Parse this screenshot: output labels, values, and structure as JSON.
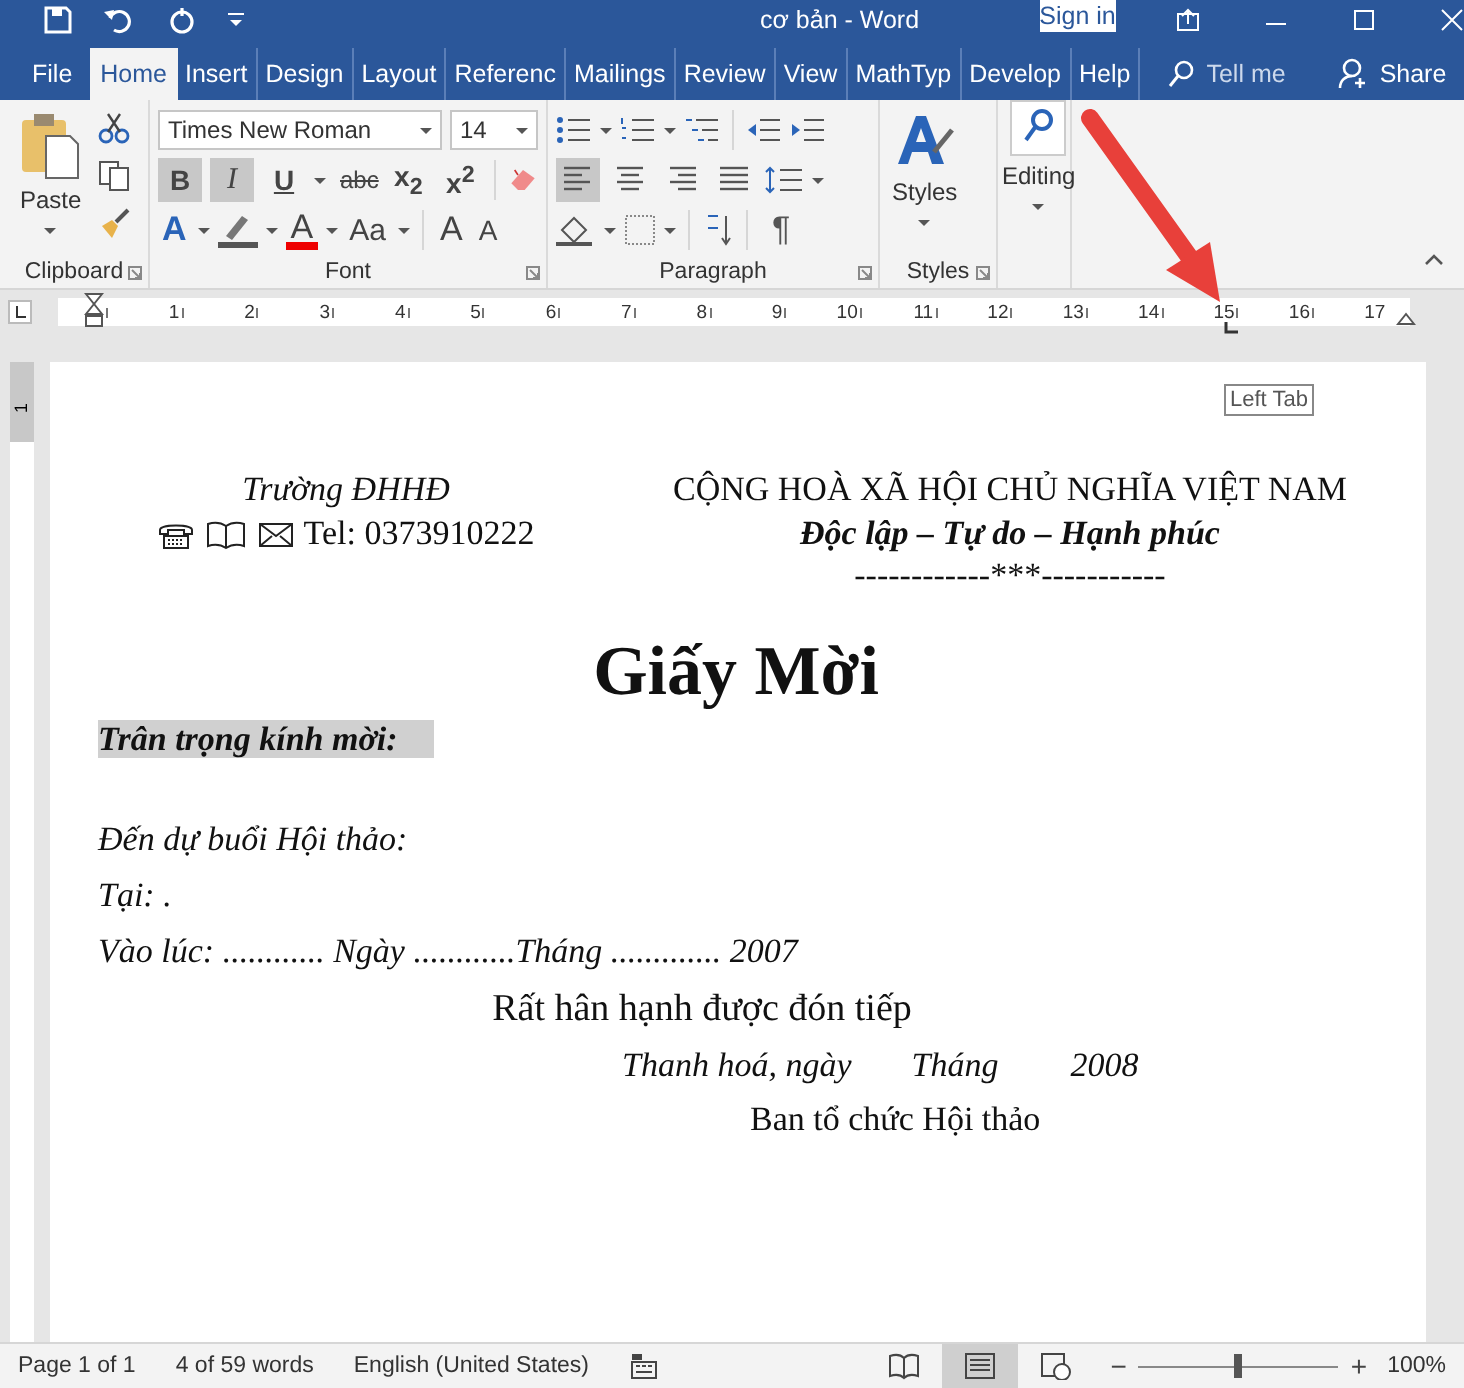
{
  "title_bar": {
    "title": "cơ bản - Word",
    "sign_in": "Sign in"
  },
  "tabs": [
    {
      "label": "File",
      "selected": false
    },
    {
      "label": "Home",
      "selected": true
    },
    {
      "label": "Insert",
      "selected": false
    },
    {
      "label": "Design",
      "selected": false
    },
    {
      "label": "Layout",
      "selected": false
    },
    {
      "label": "Referenc",
      "selected": false
    },
    {
      "label": "Mailings",
      "selected": false
    },
    {
      "label": "Review",
      "selected": false
    },
    {
      "label": "View",
      "selected": false
    },
    {
      "label": "MathTyp",
      "selected": false
    },
    {
      "label": "Develop",
      "selected": false
    },
    {
      "label": "Help",
      "selected": false
    }
  ],
  "tell_me": "Tell me",
  "share": "Share",
  "ribbon": {
    "clipboard": {
      "paste": "Paste",
      "label": "Clipboard"
    },
    "font": {
      "name": "Times New Roman",
      "size": "14",
      "label": "Font",
      "format_buttons": [
        {
          "label": "B",
          "kind": "bold",
          "on": true
        },
        {
          "label": "I",
          "kind": "italic",
          "on": true
        },
        {
          "label": "U",
          "kind": "underline",
          "on": false
        },
        {
          "label": "abc",
          "kind": "strike",
          "on": false
        },
        {
          "label": "x$_{2}$",
          "kind": "plain",
          "on": false
        },
        {
          "label": "x$^{2}$",
          "kind": "plain",
          "on": false
        }
      ],
      "text_buttons": [
        {
          "label": "A",
          "kind": "effects"
        },
        {
          "label": "A",
          "kind": "color"
        },
        {
          "label": "Aa",
          "kind": "case"
        },
        {
          "label": "A",
          "kind": "grow"
        },
        {
          "label": "A",
          "kind": "shrink"
        }
      ]
    },
    "paragraph": {
      "label": "Paragraph",
      "show_marks": "¶",
      "alignments": [
        {
          "selected": true
        },
        {
          "selected": false
        },
        {
          "selected": false
        },
        {
          "selected": false
        }
      ]
    },
    "styles": {
      "button": "Styles",
      "label": "Styles"
    },
    "editing": {
      "button": "Editing"
    }
  },
  "ruler": {
    "numbers": [
      "1",
      "2",
      "3",
      "4",
      "5",
      "6",
      "7",
      "8",
      "9",
      "10",
      "11",
      "12",
      "13",
      "14",
      "15",
      "16",
      "17"
    ],
    "tooltip": "Left Tab"
  },
  "vertical_ruler": [
    "1"
  ],
  "document": {
    "school": "Trường ĐHHĐ",
    "tel": "Tel: 0373910222",
    "country": "CỘNG HOÀ XÃ HỘI CHỦ NGHĨA VIỆT NAM",
    "motto": "Độc lập – Tự do – Hạnh phúc",
    "divider": "------------***-----------",
    "title": "Giấy Mời",
    "lines": [
      {
        "text": "Trân trọng kính mời:",
        "kind": "greeting",
        "highlighted": true
      },
      {
        "text": "Đến dự buổi Hội thảo:",
        "kind": "field",
        "highlighted": false
      },
      {
        "text": "Tại: .",
        "kind": "field",
        "highlighted": false
      },
      {
        "text": "Vào lúc: ............ Ngày ............Tháng ............. 2007",
        "kind": "field",
        "highlighted": false
      }
    ],
    "welcome": "Rất hân hạnh được đón tiếp",
    "date": [
      "Thanh hoá, ngày",
      "Tháng",
      "2008"
    ],
    "signature": "Ban tổ chức Hội thảo"
  },
  "status_bar": {
    "page": "Page 1 of 1",
    "words": "4 of 59 words",
    "language": "English (United States)",
    "views": [
      {
        "kind": "read",
        "selected": false
      },
      {
        "kind": "print",
        "selected": true
      },
      {
        "kind": "web",
        "selected": false
      }
    ],
    "zoom": {
      "zoom_out": "−",
      "level": 0.5,
      "zoom_in": "+",
      "reading": "100%"
    }
  }
}
